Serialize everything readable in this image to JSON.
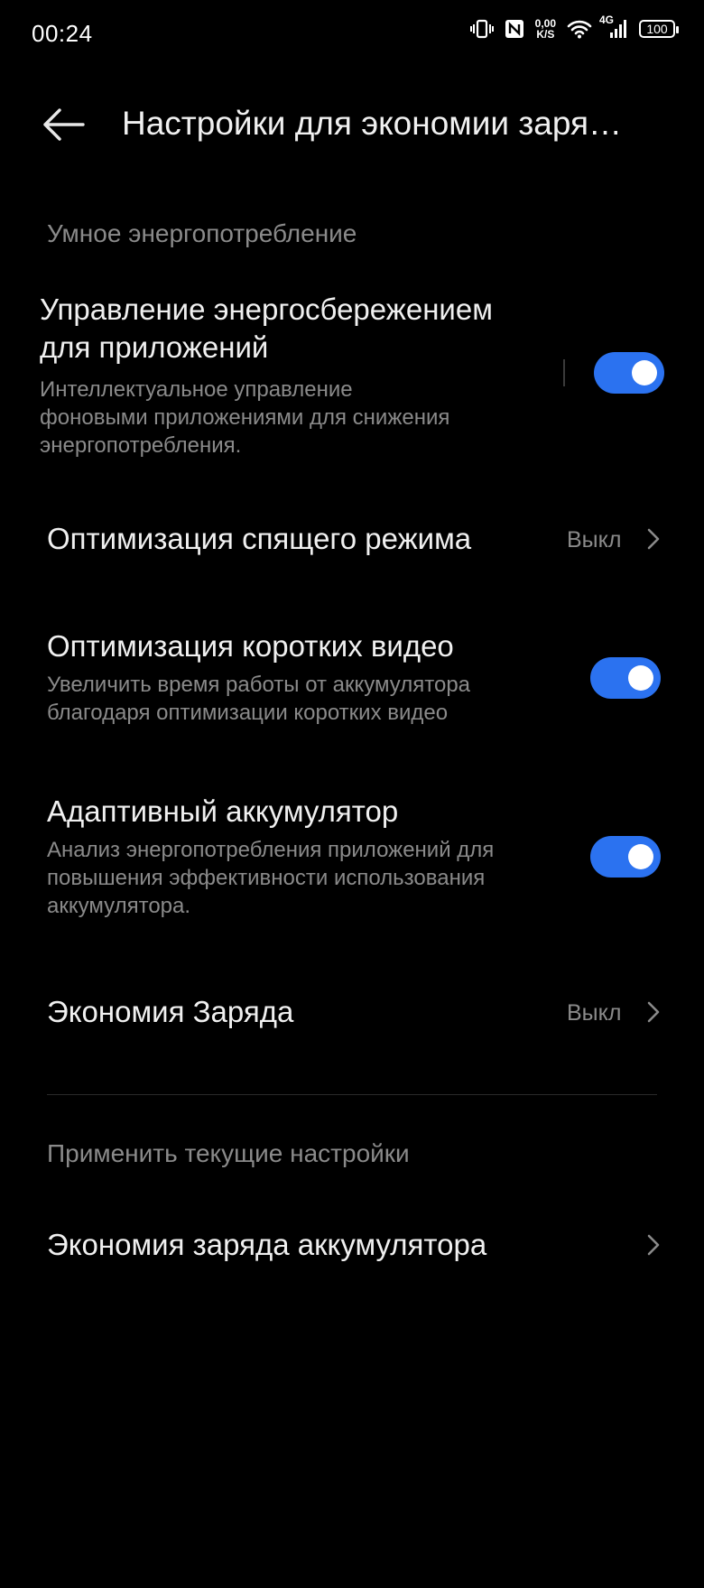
{
  "status_bar": {
    "time": "00:24",
    "net_speed_value": "0,00",
    "net_speed_unit": "K/S",
    "network_type": "4G",
    "battery_level": "100"
  },
  "header": {
    "title": "Настройки для экономии заря…"
  },
  "sections": {
    "smart": {
      "label": "Умное энергопотребление"
    },
    "apply": {
      "label": "Применить текущие настройки"
    }
  },
  "items": {
    "app_power": {
      "title_line1": "Управление энергосбережением",
      "title_line2": "для приложений",
      "sub_line1": "Интеллектуальное управление",
      "sub_line2": "фоновыми приложениями для снижения",
      "sub_line3": "энергопотребления.",
      "enabled": true
    },
    "sleep_opt": {
      "title": "Оптимизация спящего режима",
      "value": "Выкл"
    },
    "short_video": {
      "title": "Оптимизация коротких видео",
      "sub_line1": "Увеличить время работы от аккумулятора",
      "sub_line2": "благодаря оптимизации коротких видео",
      "enabled": true
    },
    "adaptive": {
      "title": "Адаптивный аккумулятор",
      "sub_line1": "Анализ энергопотребления приложений для",
      "sub_line2": "повышения эффективности использования",
      "sub_line3": "аккумулятора.",
      "enabled": true
    },
    "saver": {
      "title": "Экономия Заряда",
      "value": "Выкл"
    },
    "battery_saver": {
      "title": "Экономия заряда аккумулятора"
    }
  },
  "colors": {
    "accent": "#2b72f0",
    "background": "#000000",
    "secondary_text": "#8a8a8a"
  }
}
